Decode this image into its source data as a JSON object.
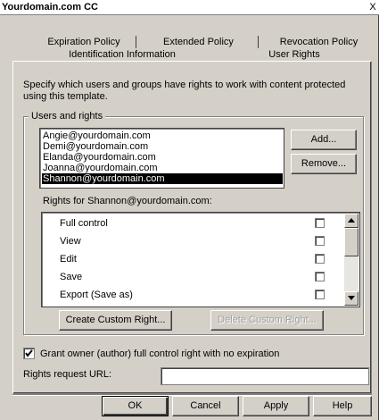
{
  "window": {
    "title": "Yourdomain.com CC",
    "close_glyph": "X"
  },
  "tabs": {
    "row1": [
      "Expiration Policy",
      "Extended Policy",
      "Revocation Policy"
    ],
    "row2": [
      "Identification Information",
      "User Rights"
    ],
    "active": "User Rights"
  },
  "description": "Specify which users and groups have rights to work with content protected using this template.",
  "users_group": {
    "legend": "Users and rights",
    "users": [
      "Angie@yourdomain.com",
      "Demi@yourdomain.com",
      "Elanda@yourdomain.com",
      "Joanna@yourdomain.com",
      "Shannon@yourdomain.com"
    ],
    "selected_user": "Shannon@yourdomain.com",
    "add_label": "Add...",
    "remove_label": "Remove...",
    "rights_caption": "Rights for Shannon@yourdomain.com:",
    "rights": [
      {
        "label": "Full control",
        "checked": false
      },
      {
        "label": "View",
        "checked": false
      },
      {
        "label": "Edit",
        "checked": false
      },
      {
        "label": "Save",
        "checked": false
      },
      {
        "label": "Export (Save as)",
        "checked": false
      }
    ],
    "create_custom_label": "Create Custom Right...",
    "delete_custom_label": "Delete Custom Right..."
  },
  "grant_owner": {
    "label": "Grant owner (author) full control right with no expiration",
    "checked": true
  },
  "rights_request_url": {
    "label": "Rights request URL:",
    "value": ""
  },
  "buttons": {
    "ok": "OK",
    "cancel": "Cancel",
    "apply": "Apply",
    "help": "Help"
  }
}
